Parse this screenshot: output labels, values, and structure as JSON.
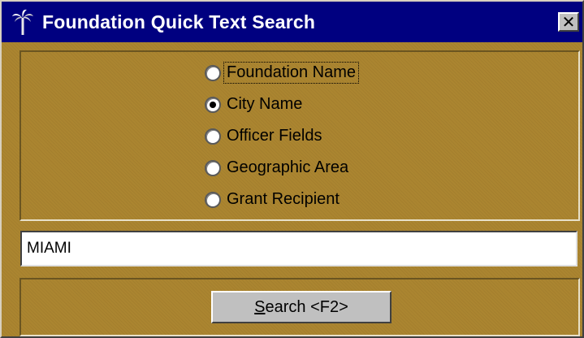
{
  "window": {
    "title": "Foundation Quick Text Search",
    "icon": "palm-tree-icon",
    "close_label": "✕"
  },
  "search_options": {
    "selected": "City Name",
    "focused": "Foundation Name",
    "items": [
      {
        "label": "Foundation Name"
      },
      {
        "label": "City Name"
      },
      {
        "label": "Officer Fields"
      },
      {
        "label": "Geographic Area"
      },
      {
        "label": "Grant Recipient"
      }
    ]
  },
  "search_input": {
    "value": "MIAMI"
  },
  "search_button": {
    "accelerator": "S",
    "label_rest": "earch <F2>"
  },
  "colors": {
    "titlebar": "#000080",
    "panel": "#ab8530",
    "button_face": "#c0c0c0"
  }
}
